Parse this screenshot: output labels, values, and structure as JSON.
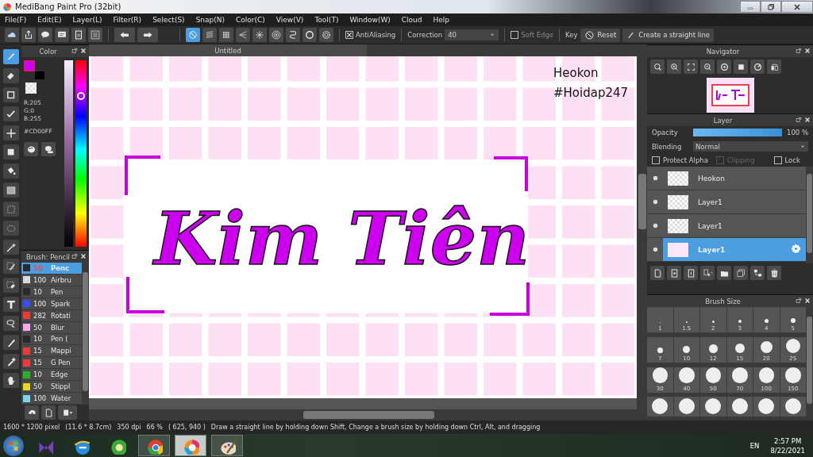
{
  "window": {
    "title": "MediBang Paint Pro (32bit)"
  },
  "menu": [
    "File(F)",
    "Edit(E)",
    "Layer(L)",
    "Filter(R)",
    "Select(S)",
    "Snap(N)",
    "Color(C)",
    "View(V)",
    "Tool(T)",
    "Window(W)",
    "Cloud",
    "Help"
  ],
  "toolbar": {
    "snaps": [
      {
        "selected": true
      },
      {
        "selected": false
      },
      {
        "selected": false
      },
      {
        "selected": false
      },
      {
        "selected": false
      },
      {
        "selected": false
      },
      {
        "selected": false
      },
      {
        "selected": false
      },
      {
        "selected": false
      }
    ],
    "antialiasing": {
      "label": "AntiAliasing",
      "checked": true
    },
    "correction": {
      "label": "Correction",
      "value": "40"
    },
    "soft_edge": {
      "label": "Soft Edge",
      "checked": false
    },
    "key_label": "Key",
    "reset": "Reset",
    "straight_line": "Create a straight line"
  },
  "tools": [
    {
      "selected": true
    },
    {
      "selected": false
    },
    {
      "selected": false
    },
    {
      "selected": false
    },
    {
      "selected": false
    },
    {
      "selected": false
    },
    {
      "selected": false
    },
    {
      "selected": false
    },
    {
      "selected": false
    },
    {
      "selected": false
    },
    {
      "selected": false
    },
    {
      "selected": false
    },
    {
      "selected": false
    },
    {
      "selected": false
    },
    {
      "selected": false
    },
    {
      "selected": false
    },
    {
      "selected": false
    },
    {
      "selected": false
    }
  ],
  "color_panel": {
    "title": "Color",
    "swatches": [
      {
        "color": "#cd00ff"
      },
      {
        "color": "#000000"
      }
    ],
    "r": "R:205",
    "g": "G:0",
    "b": "B:255",
    "hex": "#CD00FF"
  },
  "brush_panel": {
    "title": "Brush: Pencil",
    "brushes": [
      {
        "size": "10",
        "name": "Penc",
        "color": "#2a2a2a",
        "selected": true
      },
      {
        "size": "100",
        "name": "Airbru",
        "color": "#d8d8d8",
        "selected": false
      },
      {
        "size": "10",
        "name": "Pen",
        "color": "#2a2a2a",
        "selected": false
      },
      {
        "size": "100",
        "name": "Spark",
        "color": "#3a4ef0",
        "selected": false
      },
      {
        "size": "282",
        "name": "Rotati",
        "color": "#f03a3a",
        "selected": false
      },
      {
        "size": "50",
        "name": "Blur",
        "color": "#f5a8f0",
        "selected": false
      },
      {
        "size": "10",
        "name": "Pen (",
        "color": "#2a2a2a",
        "selected": false
      },
      {
        "size": "15",
        "name": "Mappi",
        "color": "#f03a3a",
        "selected": false
      },
      {
        "size": "15",
        "name": "G Pen",
        "color": "#f03a3a",
        "selected": false
      },
      {
        "size": "10",
        "name": "Edge",
        "color": "#22b422",
        "selected": false
      },
      {
        "size": "50",
        "name": "Stippl",
        "color": "#e8d81a",
        "selected": false
      },
      {
        "size": "100",
        "name": "Water",
        "color": "#78d8f0",
        "selected": false
      }
    ]
  },
  "canvas": {
    "tab": "Untitled",
    "artwork_text": "Kim Tiên",
    "notes": [
      "Heokon",
      "#Hoidap247"
    ]
  },
  "navigator": {
    "title": "Navigator"
  },
  "layer_panel": {
    "title": "Layer",
    "opacity_label": "Opacity",
    "opacity": {
      "level": 1.0
    },
    "opacity_reading": "100 %",
    "blending_label": "Blending",
    "blending": "Normal",
    "options": [
      {
        "label": "Protect Alpha",
        "checked": false,
        "disabled": false
      },
      {
        "label": "Clipping",
        "checked": false,
        "disabled": true
      },
      {
        "label": "Lock",
        "checked": false,
        "disabled": false
      }
    ],
    "layers": [
      {
        "name": "Heokon",
        "selected": false
      },
      {
        "name": "Layer1",
        "selected": false
      },
      {
        "name": "Layer1",
        "selected": false
      },
      {
        "name": "Layer1",
        "selected": true
      }
    ]
  },
  "brush_size": {
    "title": "Brush Size",
    "sizes": [
      "1",
      "1.5",
      "2",
      "3",
      "4",
      "5",
      "7",
      "10",
      "12",
      "15",
      "20",
      "25",
      "30",
      "40",
      "50",
      "70",
      "100",
      "150"
    ]
  },
  "status_bar": [
    "1600 * 1200 pixel",
    "(11.6 * 8.7cm)",
    "350 dpi",
    "66 %",
    "( 625, 940 )",
    "Draw a straight line by holding down Shift, Change a brush size by holding down Ctrl, Alt, and dragging"
  ],
  "taskbar": {
    "apps": [
      {
        "selected": false
      },
      {
        "selected": false
      },
      {
        "selected": false
      },
      {
        "selected": false
      },
      {
        "selected": true
      },
      {
        "selected": false
      }
    ],
    "language": "EN",
    "time": "2:57 PM",
    "date": "8/22/2021"
  }
}
